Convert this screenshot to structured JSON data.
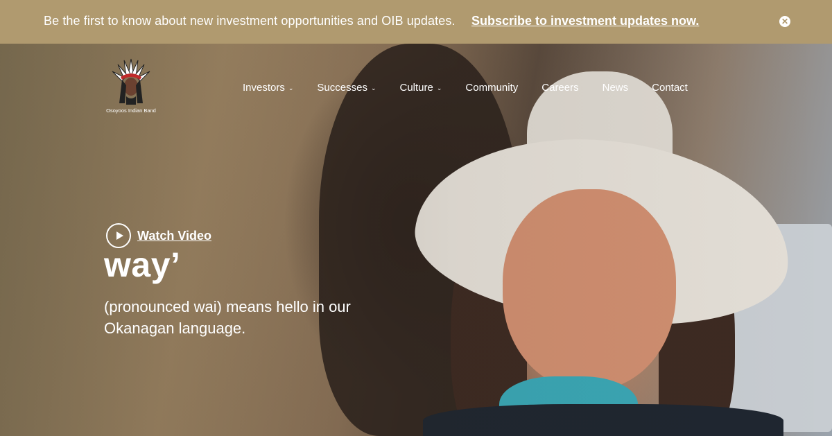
{
  "announcement": {
    "message": "Be the first to know about new investment opportunities and OIB updates.",
    "link": "Subscribe to investment updates now.",
    "close_icon": "close-icon",
    "background": "#b09a6f"
  },
  "logo": {
    "name": "Osoyoos Indian Band",
    "icon": "headdress-logo"
  },
  "nav": {
    "items": [
      {
        "label": "Investors",
        "dropdown": true
      },
      {
        "label": "Successes",
        "dropdown": true
      },
      {
        "label": "Culture",
        "dropdown": true
      },
      {
        "label": "Community",
        "dropdown": false
      },
      {
        "label": "Careers",
        "dropdown": false
      },
      {
        "label": "News",
        "dropdown": false
      },
      {
        "label": "Contact",
        "dropdown": false
      }
    ],
    "chevron": "⌄"
  },
  "hero": {
    "watch_label": "Watch Video",
    "headline": "way’",
    "description": "(pronounced wai) means hello in our Okanagan language."
  }
}
